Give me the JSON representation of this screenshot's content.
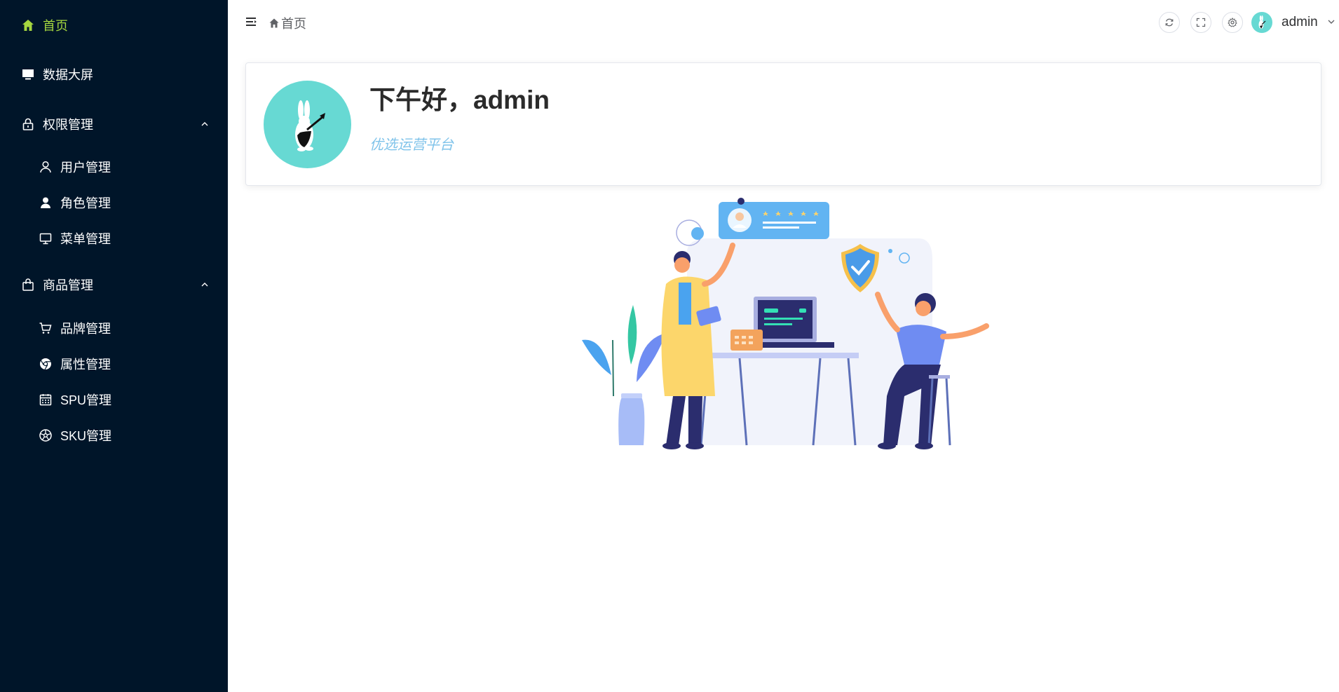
{
  "sidebar": {
    "home": "首页",
    "dashboard": "数据大屏",
    "acl": {
      "label": "权限管理",
      "items": [
        "用户管理",
        "角色管理",
        "菜单管理"
      ]
    },
    "product": {
      "label": "商品管理",
      "items": [
        "品牌管理",
        "属性管理",
        "SPU管理",
        "SKU管理"
      ]
    }
  },
  "header": {
    "breadcrumb": "首页",
    "username": "admin"
  },
  "welcome": {
    "greeting": "下午好，admin",
    "subtitle": "优选运营平台"
  },
  "colors": {
    "sidebar_bg": "#001529",
    "active": "#a5d63f",
    "avatar_bg": "#67d9d3",
    "subtitle": "#7fc3ea"
  }
}
